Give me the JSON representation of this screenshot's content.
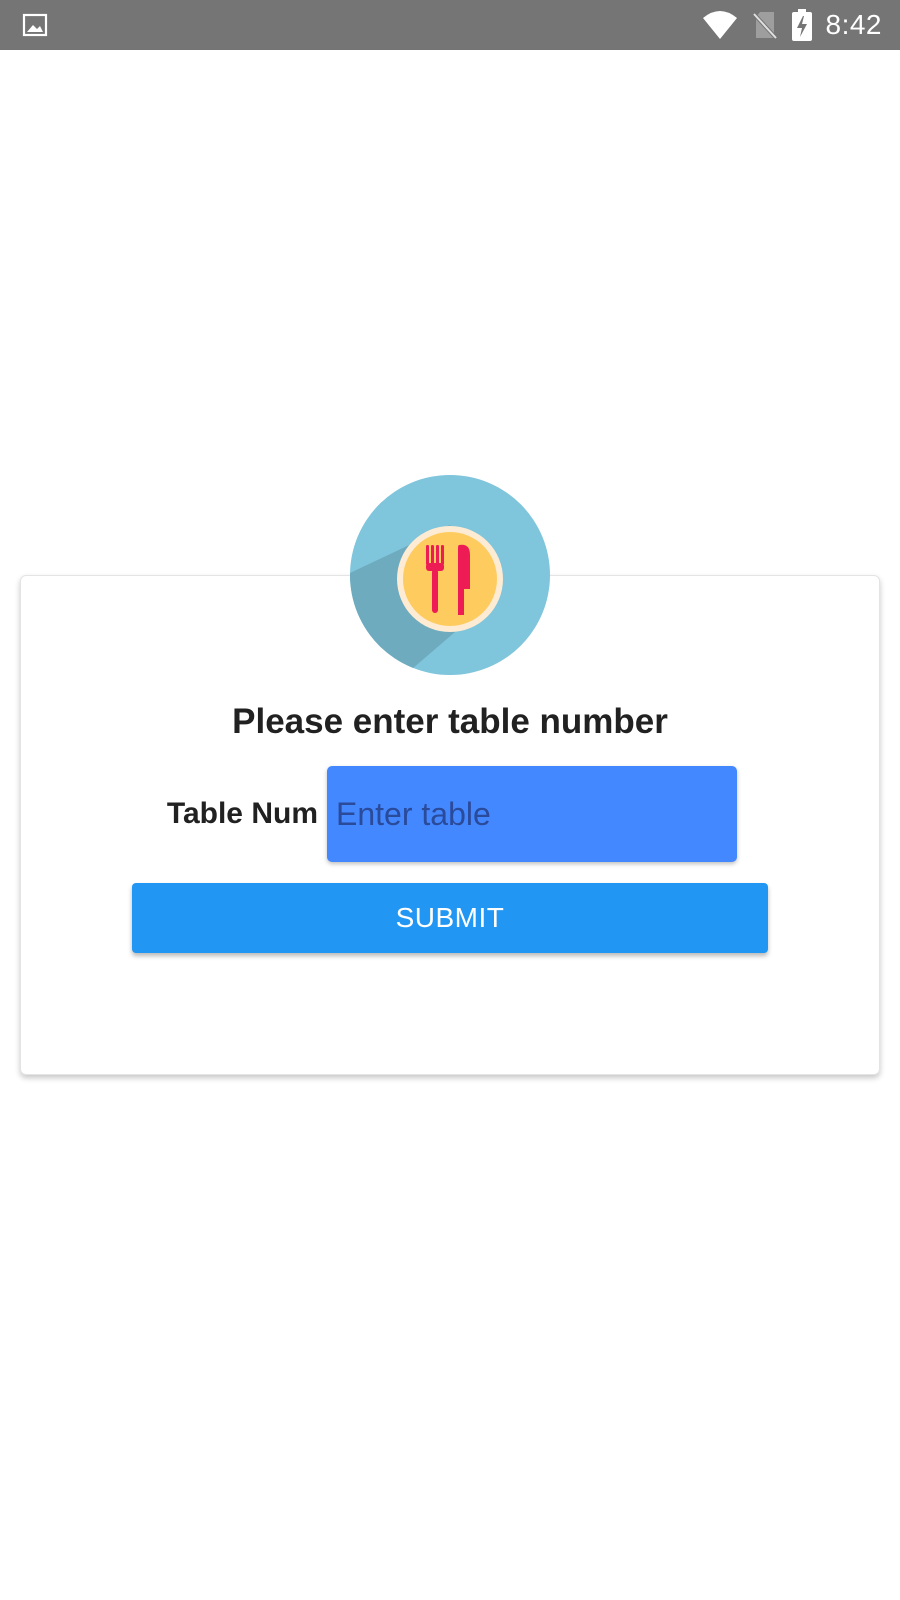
{
  "status_bar": {
    "time": "8:42",
    "icons": [
      "image-notification-icon",
      "wifi-icon",
      "no-sim-icon",
      "battery-charging-icon"
    ]
  },
  "form": {
    "title": "Please enter table number",
    "table_label": "Table Num",
    "table_placeholder": "Enter table",
    "table_value": "",
    "submit_label": "SUBMIT"
  },
  "logo": {
    "icon": "restaurant-cutlery-icon",
    "colors": {
      "outer_circle": "#7fc5dc",
      "shadow": "#6eabbf",
      "plate": "#fecb5e",
      "plate_rim": "#fdebd3",
      "cutlery": "#ee1c54"
    }
  },
  "colors": {
    "status_bar": "#757575",
    "input_bg": "#4488ff",
    "submit_bg": "#2196f3"
  }
}
